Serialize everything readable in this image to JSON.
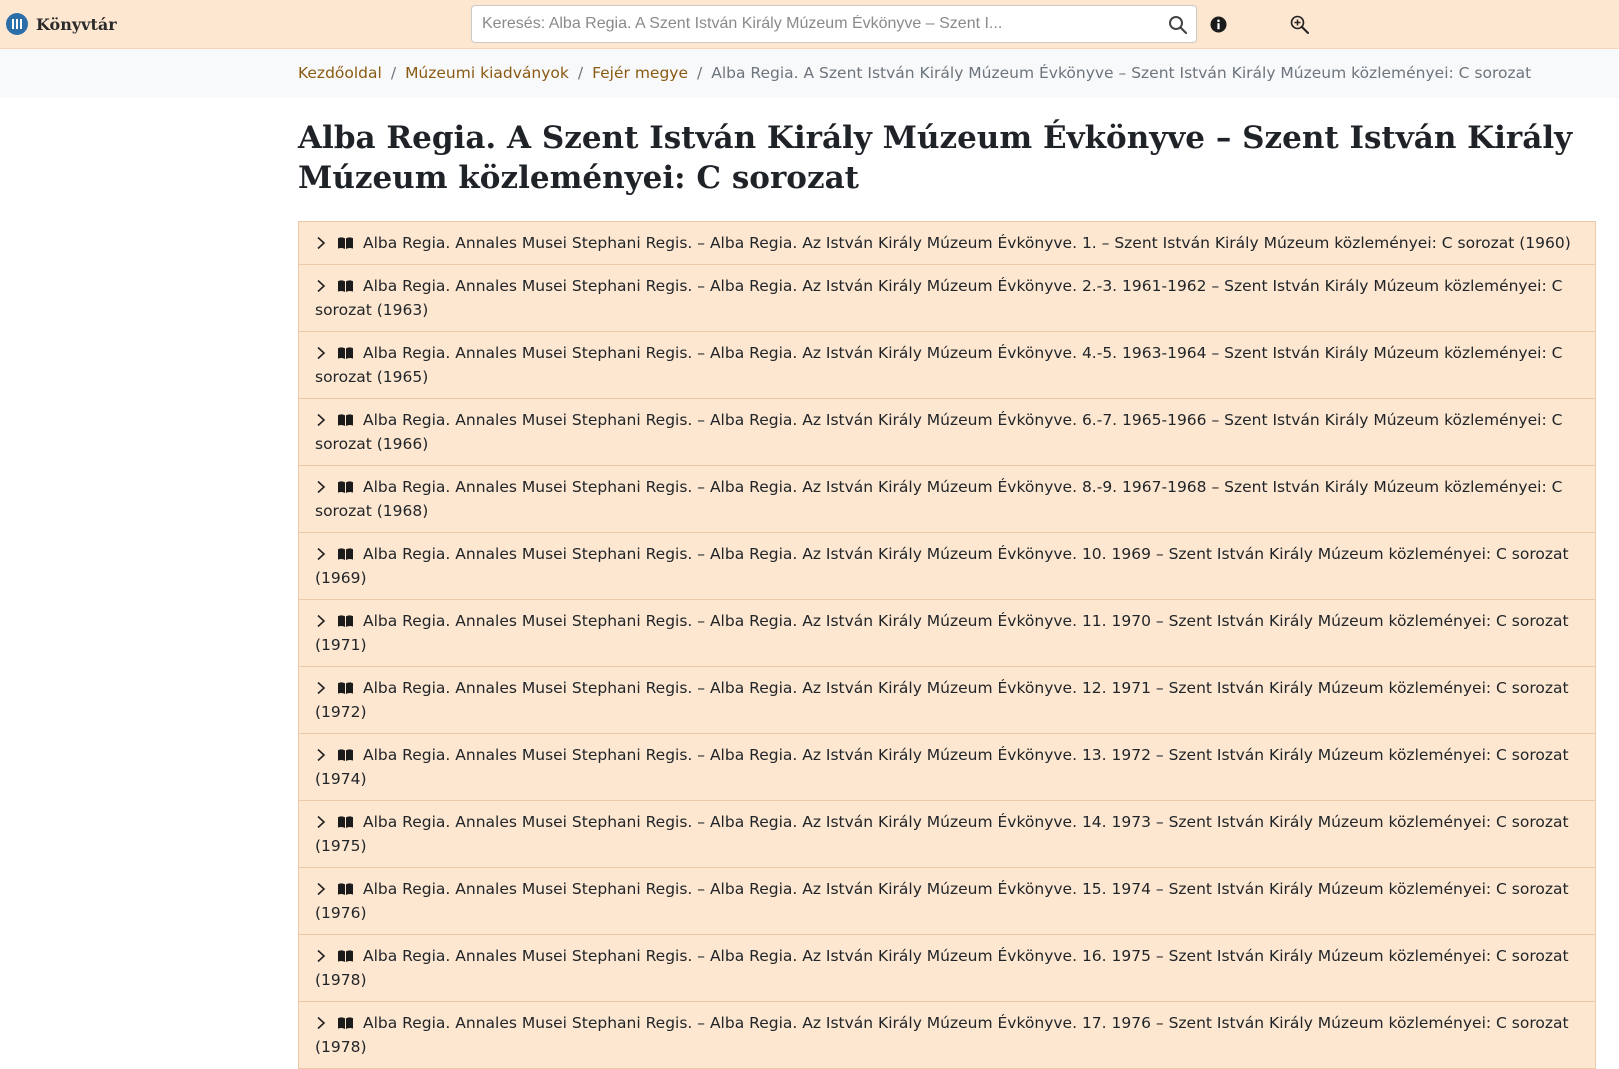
{
  "header": {
    "brand": "Könyvtár",
    "search_placeholder": "Keresés: Alba Regia. A Szent István Király Múzeum Évkönyve – Szent I..."
  },
  "breadcrumb": {
    "items": [
      "Kezdőoldal",
      "Múzeumi kiadványok",
      "Fejér megye"
    ],
    "current": "Alba Regia. A Szent István Király Múzeum Évkönyve – Szent István Király Múzeum közleményei: C sorozat"
  },
  "page": {
    "title": "Alba Regia. A Szent István Király Múzeum Évkönyve – Szent István Király Múzeum közleményei: C sorozat"
  },
  "list": {
    "items": [
      "Alba Regia. Annales Musei Stephani Regis. – Alba Regia. Az István Király Múzeum Évkönyve. 1. – Szent István Király Múzeum közleményei: C sorozat (1960)",
      "Alba Regia. Annales Musei Stephani Regis. – Alba Regia. Az István Király Múzeum Évkönyve. 2.-3. 1961-1962 – Szent István Király Múzeum közleményei: C sorozat (1963)",
      "Alba Regia. Annales Musei Stephani Regis. – Alba Regia. Az István Király Múzeum Évkönyve. 4.-5. 1963-1964 – Szent István Király Múzeum közleményei: C sorozat (1965)",
      "Alba Regia. Annales Musei Stephani Regis. – Alba Regia. Az István Király Múzeum Évkönyve. 6.-7. 1965-1966 – Szent István Király Múzeum közleményei: C sorozat (1966)",
      "Alba Regia. Annales Musei Stephani Regis. – Alba Regia. Az István Király Múzeum Évkönyve. 8.-9. 1967-1968 – Szent István Király Múzeum közleményei: C sorozat (1968)",
      "Alba Regia. Annales Musei Stephani Regis. – Alba Regia. Az István Király Múzeum Évkönyve. 10. 1969 – Szent István Király Múzeum közleményei: C sorozat (1969)",
      "Alba Regia. Annales Musei Stephani Regis. – Alba Regia. Az István Király Múzeum Évkönyve. 11. 1970 – Szent István Király Múzeum közleményei: C sorozat (1971)",
      "Alba Regia. Annales Musei Stephani Regis. – Alba Regia. Az István Király Múzeum Évkönyve. 12. 1971 – Szent István Király Múzeum közleményei: C sorozat (1972)",
      "Alba Regia. Annales Musei Stephani Regis. – Alba Regia. Az István Király Múzeum Évkönyve. 13. 1972 – Szent István Király Múzeum közleményei: C sorozat (1974)",
      "Alba Regia. Annales Musei Stephani Regis. – Alba Regia. Az István Király Múzeum Évkönyve. 14. 1973 – Szent István Király Múzeum közleményei: C sorozat (1975)",
      "Alba Regia. Annales Musei Stephani Regis. – Alba Regia. Az István Király Múzeum Évkönyve. 15. 1974 – Szent István Király Múzeum közleményei: C sorozat (1976)",
      "Alba Regia. Annales Musei Stephani Regis. – Alba Regia. Az István Király Múzeum Évkönyve. 16. 1975 – Szent István Király Múzeum közleményei: C sorozat (1978)",
      "Alba Regia. Annales Musei Stephani Regis. – Alba Regia. Az István Király Múzeum Évkönyve. 17. 1976 – Szent István Király Múzeum közleményei: C sorozat (1978)"
    ]
  },
  "icons": {
    "brand": "library-logo-icon",
    "search": "search-icon",
    "info": "info-icon",
    "zoom": "zoom-in-icon",
    "expand": "chevron-right-icon",
    "item": "book-icon"
  },
  "colors": {
    "header_bg": "#fde7d0",
    "list_bg": "#fde7d0",
    "link": "#8b5a12",
    "logo": "#2c6fa8"
  }
}
